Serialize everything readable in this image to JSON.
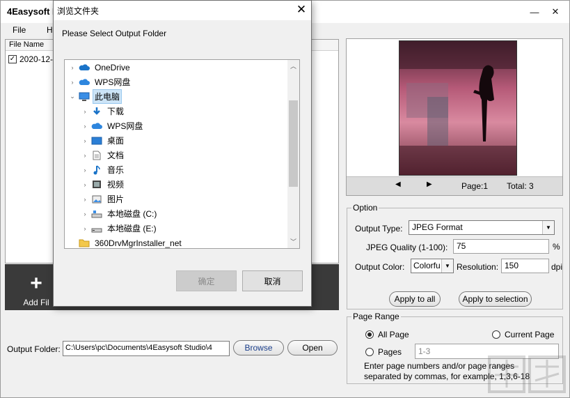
{
  "app": {
    "title": "4Easysoft P",
    "window_buttons": {
      "minimize": "—",
      "close": "✕"
    }
  },
  "menu": {
    "file": "File",
    "help": "H"
  },
  "file_list": {
    "header": "File Name",
    "rows": [
      {
        "name": "2020-12-1",
        "checked": true
      }
    ]
  },
  "toolbar": {
    "add_label": "Add Fil"
  },
  "output": {
    "label": "Output Folder:",
    "path": "C:\\Users\\pc\\Documents\\4Easysoft Studio\\4",
    "browse": "Browse",
    "open": "Open"
  },
  "preview": {
    "page_label": "Page:1",
    "total_label": "Total: 3"
  },
  "option": {
    "title": "Option",
    "output_type_label": "Output Type:",
    "output_type_value": "JPEG Format",
    "jpeg_quality_label": "JPEG Quality (1-100):",
    "jpeg_quality_value": "75",
    "jpeg_quality_unit": "%",
    "output_color_label": "Output Color:",
    "output_color_value": "Colorfu",
    "resolution_label": "Resolution:",
    "resolution_value": "150",
    "resolution_unit": "dpi",
    "apply_all": "Apply to all",
    "apply_selection": "Apply to selection"
  },
  "page_range": {
    "title": "Page Range",
    "all_page": "All Page",
    "current_page": "Current Page",
    "pages": "Pages",
    "pages_placeholder": "1-3",
    "selected": "all_page",
    "hint_line1": "Enter page numbers and/or page ranges",
    "hint_line2": "separated by commas, for example, 1,3,6-18"
  },
  "dialog": {
    "title": "浏览文件夹",
    "prompt": "Please Select Output Folder",
    "ok": "确定",
    "cancel": "取消",
    "tree": [
      {
        "label": "OneDrive",
        "icon": "cloud-icon",
        "expander": "collapsed"
      },
      {
        "label": "WPS网盘",
        "icon": "cloud-icon",
        "expander": "collapsed"
      },
      {
        "label": "此电脑",
        "icon": "computer-icon",
        "expander": "expanded",
        "selected": true
      },
      {
        "label": "下载",
        "icon": "download-icon",
        "expander": "collapsed"
      },
      {
        "label": "WPS网盘",
        "icon": "cloud-icon",
        "expander": "collapsed"
      },
      {
        "label": "桌面",
        "icon": "desktop-icon",
        "expander": "collapsed"
      },
      {
        "label": "文档",
        "icon": "document-icon",
        "expander": "collapsed"
      },
      {
        "label": "音乐",
        "icon": "music-icon",
        "expander": "collapsed"
      },
      {
        "label": "视频",
        "icon": "video-icon",
        "expander": "collapsed"
      },
      {
        "label": "图片",
        "icon": "picture-icon",
        "expander": "collapsed"
      },
      {
        "label": "本地磁盘 (C:)",
        "icon": "drive-icon",
        "expander": "collapsed"
      },
      {
        "label": "本地磁盘 (E:)",
        "icon": "drive-icon",
        "expander": "collapsed"
      },
      {
        "label": "360DrvMgrInstaller_net",
        "icon": "folder-icon",
        "expander": "none"
      }
    ]
  },
  "colors": {
    "selection": "#cce4f7",
    "toolbar": "#3a3a3a",
    "window_bg": "#f0f0f0",
    "link_blue": "#1a3e8a"
  }
}
